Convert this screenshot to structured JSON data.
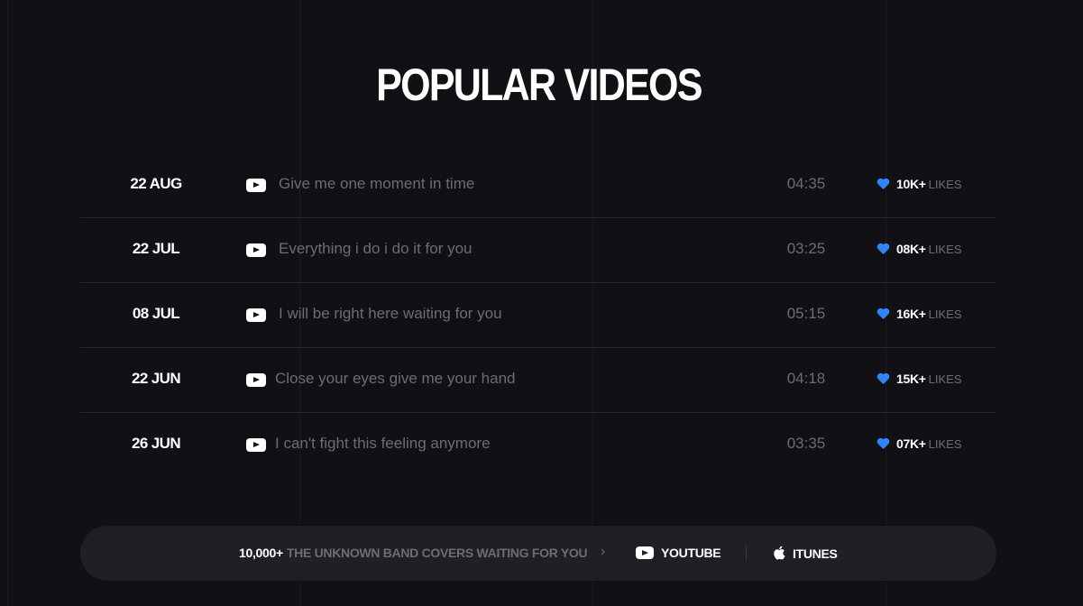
{
  "section": {
    "title": "POPULAR VIDEOS"
  },
  "videos": [
    {
      "date": "22 AUG",
      "title": "Give me one moment in time",
      "duration": "04:35",
      "likes": "10K+",
      "likes_label": "LIKES"
    },
    {
      "date": "22 JUL",
      "title": "Everything i do i do it for you",
      "duration": "03:25",
      "likes": "08K+",
      "likes_label": "LIKES"
    },
    {
      "date": "08 JUL",
      "title": "I will be right here waiting for you",
      "duration": "05:15",
      "likes": "16K+",
      "likes_label": "LIKES"
    },
    {
      "date": "22 JUN",
      "title": "Close your eyes give me your hand",
      "duration": "04:18",
      "likes": "15K+",
      "likes_label": "LIKES"
    },
    {
      "date": "26 JUN",
      "title": "I can't fight this feeling anymore",
      "duration": "03:35",
      "likes": "07K+",
      "likes_label": "LIKES"
    }
  ],
  "bottom_bar": {
    "count": "10,000+",
    "description": "THE UNKNOWN BAND COVERS WAITING FOR YOU",
    "arrow": "›",
    "youtube_label": "YOUTUBE",
    "itunes_label": "ITUNES"
  },
  "colors": {
    "background": "#111015",
    "accent_heart": "#2f86f6",
    "muted_text": "#6d6c73",
    "bar_background": "#201f25"
  },
  "icons": {
    "video": "youtube-icon",
    "likes": "heart-icon",
    "itunes": "apple-icon"
  }
}
